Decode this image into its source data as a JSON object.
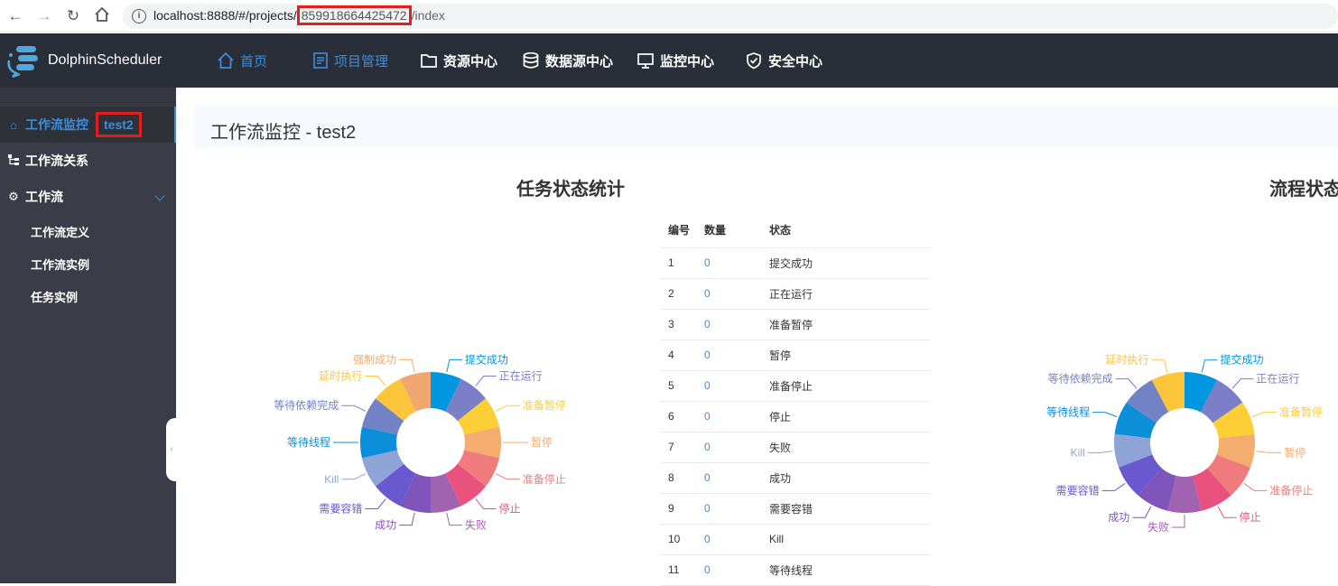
{
  "browser": {
    "url_prefix": "localhost:8888/#/projects/",
    "url_project_code": "859918664425472",
    "url_suffix": "/index"
  },
  "header": {
    "brand": "DolphinScheduler",
    "nav": [
      {
        "label": "首页",
        "icon": "home-icon"
      },
      {
        "label": "项目管理",
        "icon": "document-icon"
      },
      {
        "label": "资源中心",
        "icon": "folder-icon"
      },
      {
        "label": "数据源中心",
        "icon": "database-icon"
      },
      {
        "label": "监控中心",
        "icon": "monitor-icon"
      },
      {
        "label": "安全中心",
        "icon": "shield-icon"
      }
    ]
  },
  "sidebar": {
    "monitor": "工作流监控",
    "project_name": "test2",
    "relation": "工作流关系",
    "workflow": "工作流",
    "sub_items": [
      "工作流定义",
      "工作流实例",
      "任务实例"
    ]
  },
  "page": {
    "title": "工作流监控 - test2",
    "task_section_title": "任务状态统计",
    "process_section_title": "流程状态统计"
  },
  "table": {
    "headers": [
      "编号",
      "数量",
      "状态"
    ],
    "rows": [
      {
        "id": "1",
        "count": "0",
        "state": "提交成功"
      },
      {
        "id": "2",
        "count": "0",
        "state": "正在运行"
      },
      {
        "id": "3",
        "count": "0",
        "state": "准备暂停"
      },
      {
        "id": "4",
        "count": "0",
        "state": "暂停"
      },
      {
        "id": "5",
        "count": "0",
        "state": "准备停止"
      },
      {
        "id": "6",
        "count": "0",
        "state": "停止"
      },
      {
        "id": "7",
        "count": "0",
        "state": "失败"
      },
      {
        "id": "8",
        "count": "0",
        "state": "成功"
      },
      {
        "id": "9",
        "count": "0",
        "state": "需要容错"
      },
      {
        "id": "10",
        "count": "0",
        "state": "Kill"
      },
      {
        "id": "11",
        "count": "0",
        "state": "等待线程"
      }
    ]
  },
  "chart_data": [
    {
      "type": "pie",
      "title": "任务状态统计",
      "slices": [
        {
          "name": "提交成功",
          "value": 1,
          "color": "#0097e0"
        },
        {
          "name": "正在运行",
          "value": 1,
          "color": "#7b7fc7"
        },
        {
          "name": "准备暂停",
          "value": 1,
          "color": "#fece36"
        },
        {
          "name": "暂停",
          "value": 1,
          "color": "#f5ac6f"
        },
        {
          "name": "准备停止",
          "value": 1,
          "color": "#ef7b7c"
        },
        {
          "name": "停止",
          "value": 1,
          "color": "#e9517f"
        },
        {
          "name": "失败",
          "value": 1,
          "color": "#a163b0"
        },
        {
          "name": "成功",
          "value": 1,
          "color": "#7f55bb"
        },
        {
          "name": "需要容错",
          "value": 1,
          "color": "#6a58d1"
        },
        {
          "name": "Kill",
          "value": 1,
          "color": "#8fa4d6"
        },
        {
          "name": "等待线程",
          "value": 1,
          "color": "#0b8fd9"
        },
        {
          "name": "等待依赖完成",
          "value": 1,
          "color": "#7282c4"
        },
        {
          "name": "延时执行",
          "value": 1,
          "color": "#fcc53c"
        },
        {
          "name": "强制成功",
          "value": 1,
          "color": "#f0a870"
        }
      ]
    },
    {
      "type": "pie",
      "title": "流程状态统计",
      "slices": [
        {
          "name": "提交成功",
          "value": 1,
          "color": "#0097e0"
        },
        {
          "name": "正在运行",
          "value": 1,
          "color": "#7b7fc7"
        },
        {
          "name": "准备暂停",
          "value": 1,
          "color": "#fece36"
        },
        {
          "name": "暂停",
          "value": 1,
          "color": "#f5ac6f"
        },
        {
          "name": "准备停止",
          "value": 1,
          "color": "#ef7b7c"
        },
        {
          "name": "停止",
          "value": 1,
          "color": "#e9517f"
        },
        {
          "name": "失败",
          "value": 1,
          "color": "#a163b0"
        },
        {
          "name": "成功",
          "value": 1,
          "color": "#7f55bb"
        },
        {
          "name": "需要容错",
          "value": 1,
          "color": "#6a58d1"
        },
        {
          "name": "Kill",
          "value": 1,
          "color": "#8fa4d6"
        },
        {
          "name": "等待线程",
          "value": 1,
          "color": "#0b8fd9"
        },
        {
          "name": "等待依赖完成",
          "value": 1,
          "color": "#7282c4"
        },
        {
          "name": "延时执行",
          "value": 1,
          "color": "#fcc53c"
        }
      ]
    }
  ]
}
